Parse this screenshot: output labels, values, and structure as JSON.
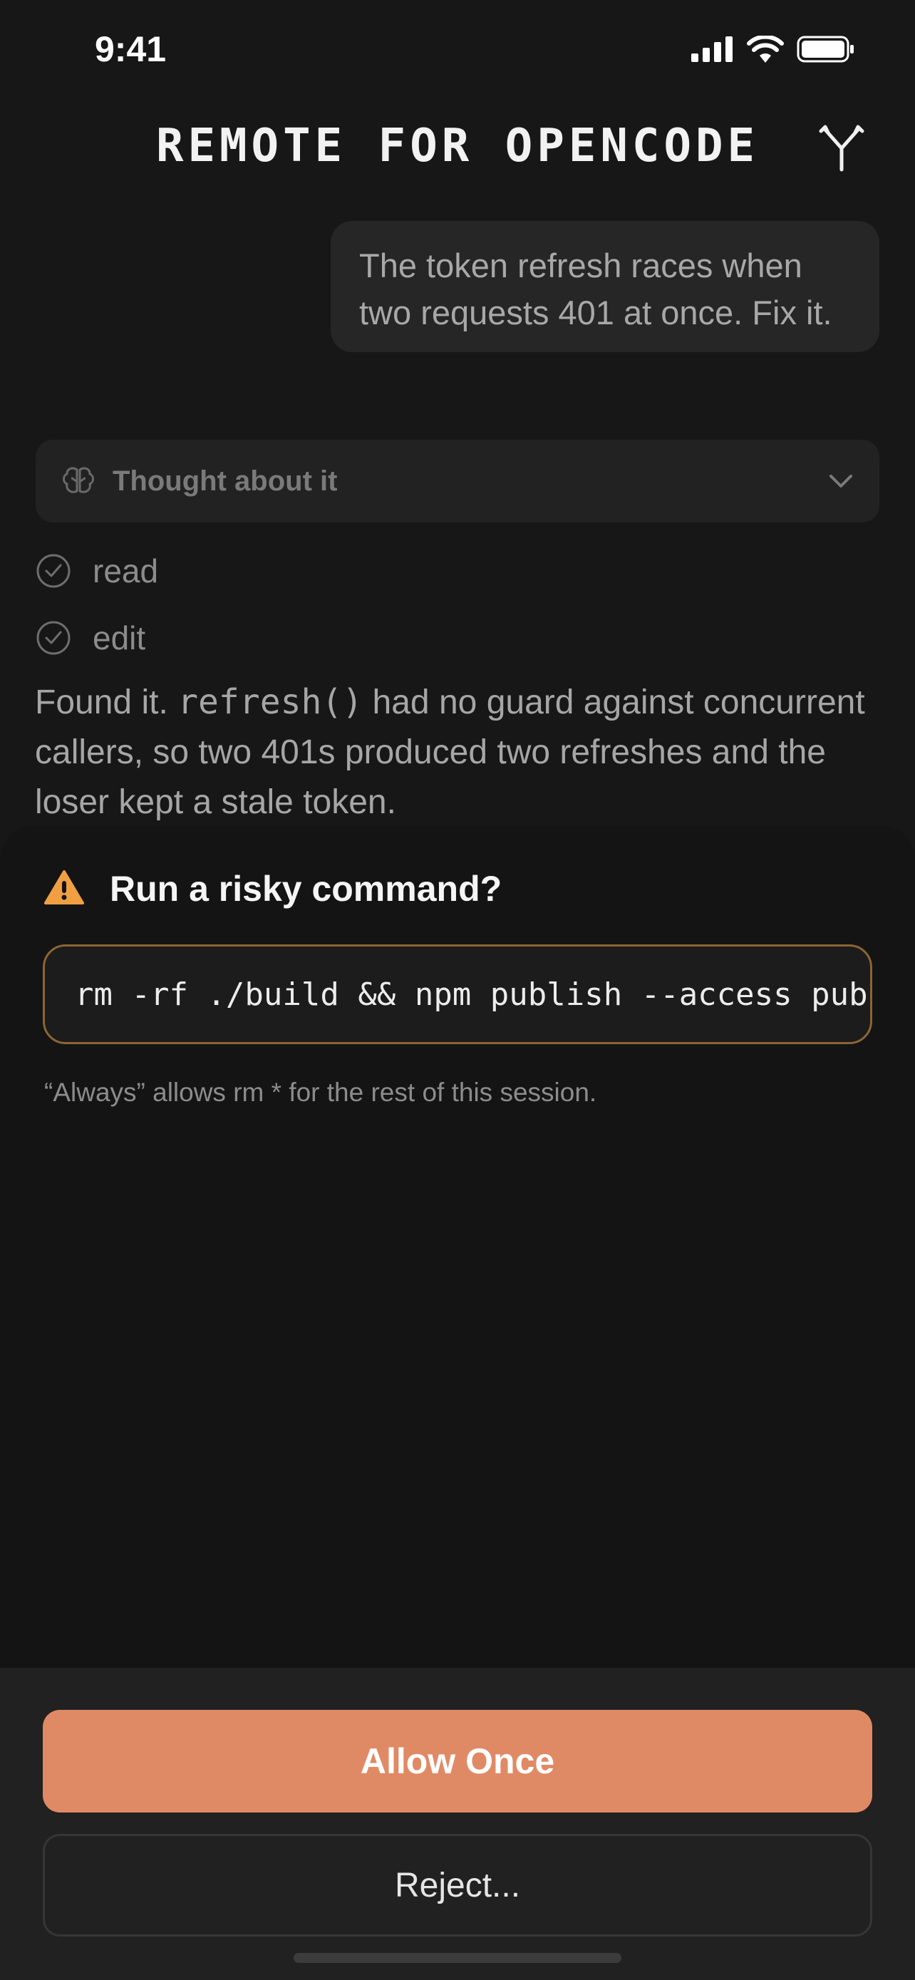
{
  "status_bar": {
    "time": "9:41"
  },
  "header": {
    "title": "REMOTE FOR OPENCODE"
  },
  "user_message": {
    "text": "The token refresh races when two requests 401 at once. Fix it."
  },
  "thought": {
    "label": "Thought about it"
  },
  "tools": [
    {
      "label": "read"
    },
    {
      "label": "edit"
    }
  ],
  "assistant": {
    "prefix": "Found it. ",
    "code": "refresh()",
    "suffix": " had no guard against concurrent callers, so two 401s produced two refreshes and the loser kept a stale token."
  },
  "permission": {
    "title": "Run a risky command?",
    "command": "rm -rf ./build && npm publish --access public",
    "hint": "“Always” allows rm * for the rest of this session."
  },
  "actions": {
    "allow_label": "Allow Once",
    "reject_label": "Reject..."
  },
  "colors": {
    "accent": "#e08a65",
    "warning": "#f0a043",
    "command_border": "#8a6535"
  }
}
